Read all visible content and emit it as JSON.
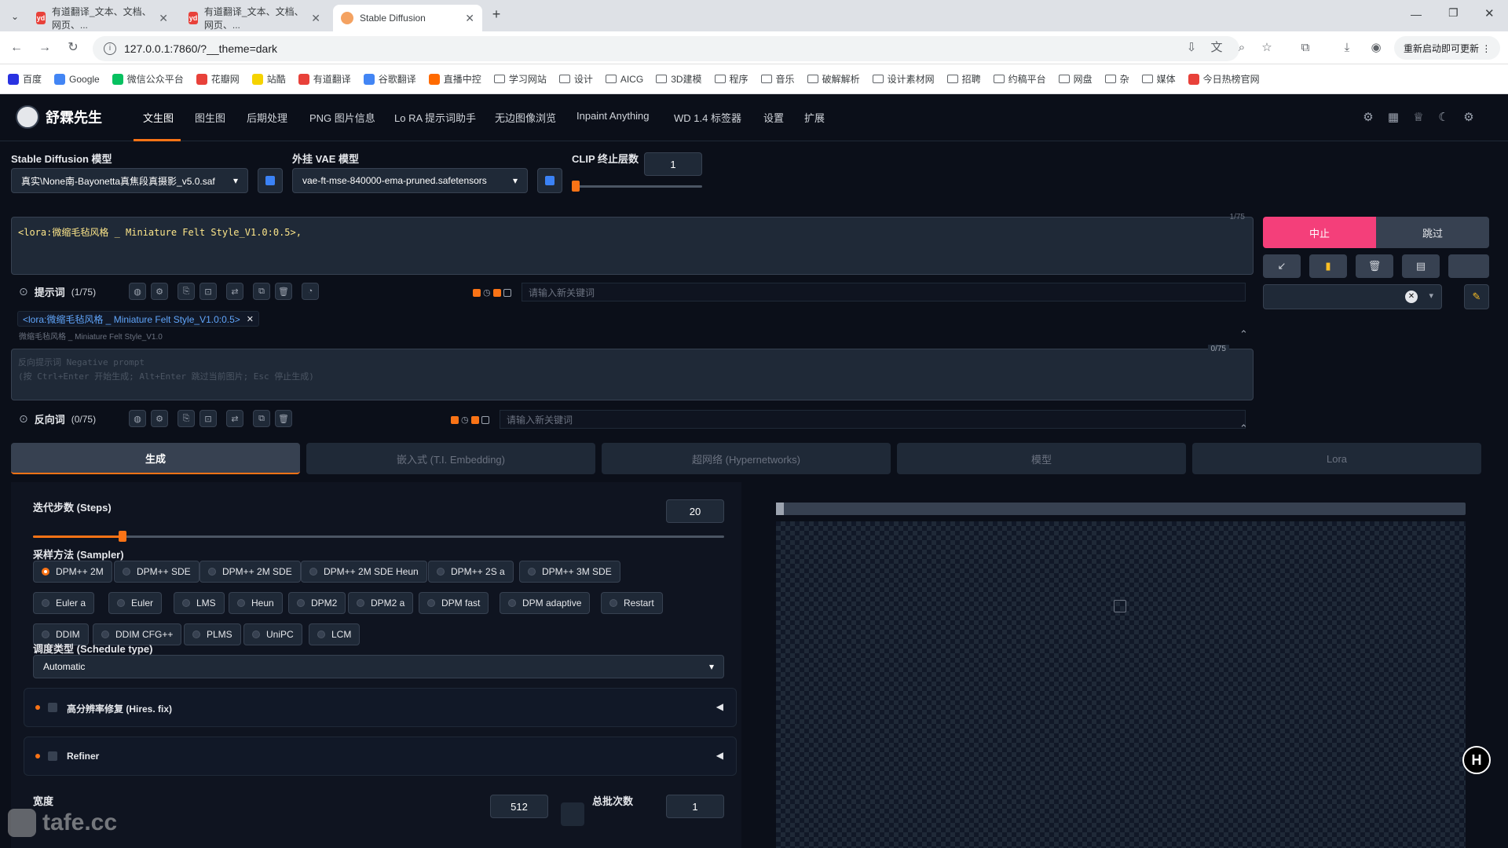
{
  "browser": {
    "tabs": [
      {
        "title": "有道翻译_文本、文档、网页、..."
      },
      {
        "title": "有道翻译_文本、文档、网页、..."
      },
      {
        "title": "Stable Diffusion"
      }
    ],
    "favicon_yd": "yd",
    "url": "127.0.0.1:7860/?__theme=dark",
    "relaunch": "重新启动即可更新 ⋮",
    "bookmarks": [
      {
        "label": "百度",
        "kind": "site",
        "color": "#2932e1"
      },
      {
        "label": "Google",
        "kind": "site",
        "color": "#4285f4"
      },
      {
        "label": "微信公众平台",
        "kind": "site",
        "color": "#07c160"
      },
      {
        "label": "花瓣网",
        "kind": "site",
        "color": "#e8413a"
      },
      {
        "label": "站酷",
        "kind": "site",
        "color": "#f5d300"
      },
      {
        "label": "有道翻译",
        "kind": "site",
        "color": "#e8413a"
      },
      {
        "label": "谷歌翻译",
        "kind": "site",
        "color": "#4285f4"
      },
      {
        "label": "直播中控",
        "kind": "site",
        "color": "#ff6a00"
      },
      {
        "label": "学习网站",
        "kind": "folder"
      },
      {
        "label": "设计",
        "kind": "folder"
      },
      {
        "label": "AICG",
        "kind": "folder"
      },
      {
        "label": "3D建模",
        "kind": "folder"
      },
      {
        "label": "程序",
        "kind": "folder"
      },
      {
        "label": "音乐",
        "kind": "folder"
      },
      {
        "label": "破解解析",
        "kind": "folder"
      },
      {
        "label": "设计素材网",
        "kind": "folder"
      },
      {
        "label": "招聘",
        "kind": "folder"
      },
      {
        "label": "约稿平台",
        "kind": "folder"
      },
      {
        "label": "网盘",
        "kind": "folder"
      },
      {
        "label": "杂",
        "kind": "folder"
      },
      {
        "label": "媒体",
        "kind": "folder"
      },
      {
        "label": "今日热榜官网",
        "kind": "site",
        "color": "#e8413a"
      }
    ]
  },
  "app": {
    "brand": "舒霖先生",
    "nav": [
      "文生图",
      "图生图",
      "后期处理",
      "PNG 图片信息",
      "Lo RA 提示词助手",
      "无边图像浏览",
      "Inpaint Anything",
      "WD 1.4 标签器",
      "设置",
      "扩展"
    ],
    "model_label": "Stable Diffusion 模型",
    "model_value": "真实\\None南-Bayonetta真焦段真摄影_v5.0.saf",
    "vae_label": "外挂 VAE 模型",
    "vae_value": "vae-ft-mse-840000-ema-pruned.safetensors",
    "clip_label": "CLIP 终止层数",
    "clip_value": "1",
    "clip_fraction": 0.0,
    "prompt_text": "<lora:微缩毛毡风格 _ Miniature Felt Style_V1.0:0.5>,",
    "prompt_counter": "1/75",
    "prompt_label": "提示词",
    "prompt_count": "(1/75)",
    "keyword_placeholder": "请输入新关键词",
    "lora_chip": "<lora:微缩毛毡风格 _ Miniature Felt Style_V1.0:0.5>",
    "lora_chip_sub": "微缩毛毡风格 _ Miniature Felt Style_V1.0",
    "neg_placeholder_1": "反向提示词 Negative prompt",
    "neg_placeholder_2": "(按 Ctrl+Enter 开始生成; Alt+Enter 跳过当前图片; Esc 停止生成)",
    "neg_counter": "0/75",
    "neg_label": "反向词",
    "neg_count": "(0/75)",
    "interrupt": "中止",
    "skip": "跳过",
    "tabs": [
      "生成",
      "嵌入式 (T.I. Embedding)",
      "超网络 (Hypernetworks)",
      "模型",
      "Lora"
    ],
    "steps_label": "迭代步数 (Steps)",
    "steps_value": "20",
    "steps_fraction": 0.13,
    "sampler_label": "采样方法 (Sampler)",
    "samplers": [
      "DPM++ 2M",
      "DPM++ SDE",
      "DPM++ 2M SDE",
      "DPM++ 2M SDE Heun",
      "DPM++ 2S a",
      "DPM++ 3M SDE",
      "Euler a",
      "Euler",
      "LMS",
      "Heun",
      "DPM2",
      "DPM2 a",
      "DPM fast",
      "DPM adaptive",
      "Restart",
      "DDIM",
      "DDIM CFG++",
      "PLMS",
      "UniPC",
      "LCM"
    ],
    "sampler_selected": "DPM++ 2M",
    "schedule_label": "调度类型 (Schedule type)",
    "schedule_value": "Automatic",
    "hires_label": "高分辨率修复 (Hires. fix)",
    "refiner_label": "Refiner",
    "width_label": "宽度",
    "width_value": "512",
    "batch_count_label": "总批次数",
    "batch_count_value": "1",
    "watermark": "tafe.cc"
  }
}
